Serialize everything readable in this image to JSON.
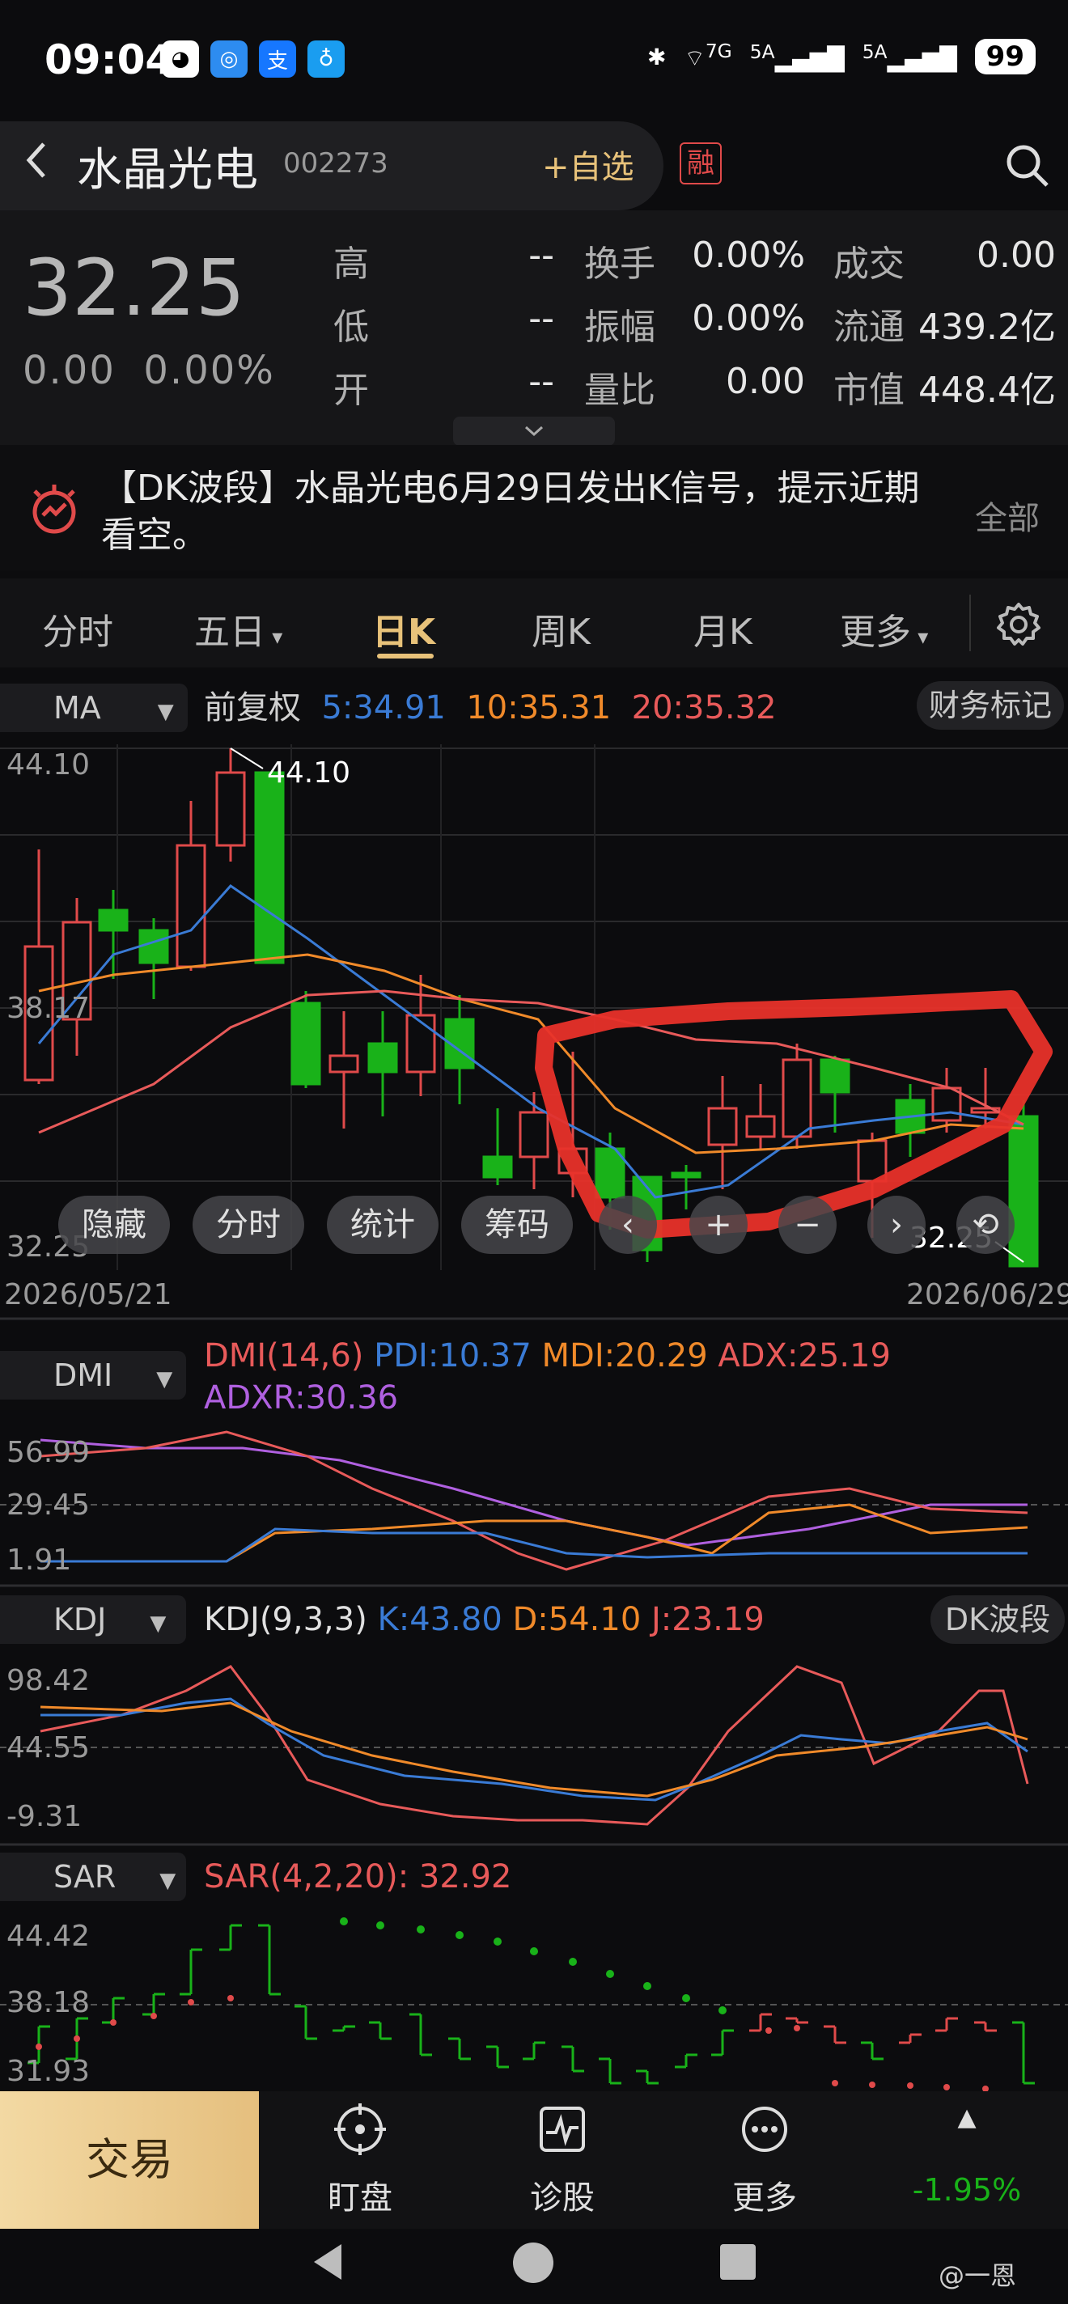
{
  "status_bar": {
    "time": "09:04",
    "network1": "7G",
    "network2": "5A",
    "network3": "5A",
    "battery": "99"
  },
  "header": {
    "back_label": "<",
    "stock_name": "水晶光电",
    "stock_code": "002273",
    "add_watchlist": "+自选",
    "margin_badge": "融"
  },
  "quote": {
    "price": "32.25",
    "change": "0.00",
    "change_pct": "0.00%",
    "rows": [
      {
        "l1": "高",
        "v1": "--",
        "l2": "换手",
        "v2": "0.00%",
        "l3": "成交",
        "v3": "0.00"
      },
      {
        "l1": "低",
        "v1": "--",
        "l2": "振幅",
        "v2": "0.00%",
        "l3": "流通",
        "v3": "439.2亿"
      },
      {
        "l1": "开",
        "v1": "--",
        "l2": "量比",
        "v2": "0.00",
        "l3": "市值",
        "v3": "448.4亿"
      }
    ]
  },
  "notice": {
    "text": "【DK波段】水晶光电6月29日发出K信号，提示近期看空。",
    "all_label": "全部"
  },
  "tabs": [
    {
      "label": "分时"
    },
    {
      "label": "五日"
    },
    {
      "label": "日K"
    },
    {
      "label": "周K"
    },
    {
      "label": "月K"
    },
    {
      "label": "更多"
    }
  ],
  "kline": {
    "indicator": "MA",
    "adjust": "前复权",
    "ma5": "5:34.91",
    "ma10": "10:35.31",
    "ma20": "20:35.32",
    "financial_mark": "财务标记",
    "y_top": "44.10",
    "y_mid": "38.17",
    "y_bottom": "32.25",
    "high_label": "44.10",
    "low_label": "32.25",
    "date_start": "2026/05/21",
    "date_end": "2026/06/29",
    "overlay_buttons": [
      "隐藏",
      "分时",
      "统计",
      "筹码"
    ]
  },
  "dmi": {
    "name": "DMI",
    "params": "DMI(14,6)",
    "pdi": "PDI:10.37",
    "mdi": "MDI:20.29",
    "adx": "ADX:25.19",
    "adxr": "ADXR:30.36",
    "y_top": "56.99",
    "y_mid": "29.45",
    "y_bottom": "1.91"
  },
  "kdj": {
    "name": "KDJ",
    "params": "KDJ(9,3,3)",
    "k": "K:43.80",
    "d": "D:54.10",
    "j": "J:23.19",
    "side_btn": "DK波段",
    "y_top": "98.42",
    "y_mid": "44.55",
    "y_bottom": "-9.31"
  },
  "sar": {
    "name": "SAR",
    "params": "SAR(4,2,20):",
    "value": "32.92",
    "y_top": "44.42",
    "y_mid": "38.18",
    "y_bottom": "31.93"
  },
  "bottom_bar": {
    "trade": "交易",
    "items": [
      "盯盘",
      "诊股",
      "更多"
    ],
    "index_change": "-1.95%"
  },
  "watermark": "@一恩",
  "colors": {
    "up": "#e04a4a",
    "down": "#19b219",
    "ma5": "#3a7bd5",
    "ma10": "#f08a2a",
    "ma20": "#e85a5a",
    "adxr": "#b060e0",
    "gold": "#e8c27a"
  }
}
